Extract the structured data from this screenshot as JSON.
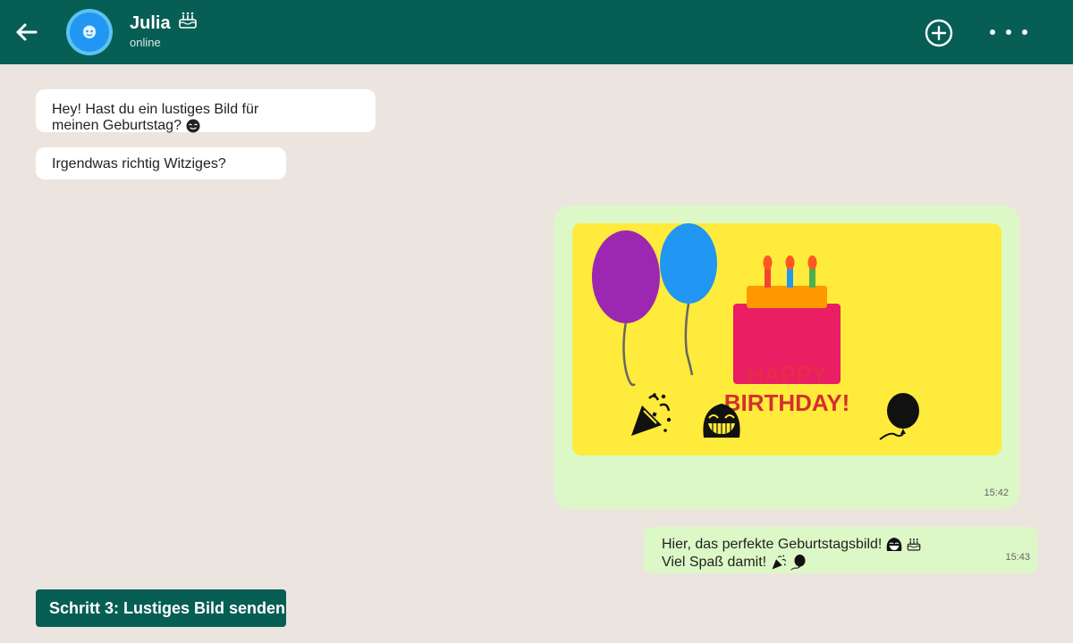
{
  "header": {
    "contact_name": "Julia",
    "status": "online",
    "colors": {
      "bar": "#075e55",
      "avatar": "#5cc3ef"
    }
  },
  "messages": {
    "incoming": [
      {
        "lines": [
          "Hey! Hast du ein lustiges Bild für",
          "meinen Geburtstag?"
        ],
        "emoji": "blush-icon"
      },
      {
        "lines": [
          "Irgendwas richtig Witziges?"
        ]
      }
    ],
    "image_message": {
      "image_text": {
        "line1": "HAPPY",
        "line2": "BIRTHDAY!"
      },
      "time": "15:42"
    },
    "outgoing": {
      "lines": [
        "Hier, das perfekte Geburtstagsbild!",
        "Viel Spaß damit!"
      ],
      "time": "15:43"
    }
  },
  "step_button": {
    "label": "Schritt 3: Lustiges Bild senden"
  },
  "icons": {
    "back": "arrow-left-icon",
    "add": "plus-circle-icon",
    "more": "more-dots-icon",
    "cake": "cake-icon",
    "party": "party-popper-icon",
    "laugh": "laughing-face-icon",
    "balloon": "balloon-icon"
  }
}
